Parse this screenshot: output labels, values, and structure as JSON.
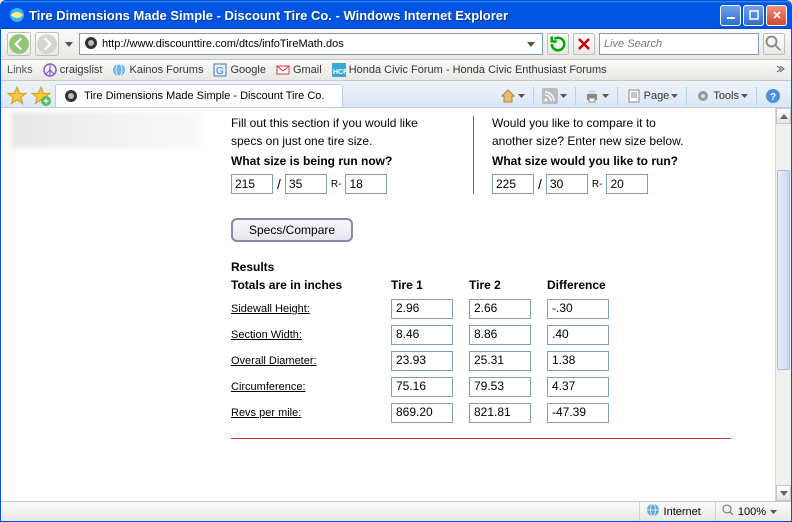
{
  "window": {
    "title": "Tire Dimensions Made Simple - Discount Tire Co. - Windows Internet Explorer"
  },
  "address": {
    "url": "http://www.discounttire.com/dtcs/infoTireMath.dos",
    "search_placeholder": "Live Search"
  },
  "links": {
    "label": "Links",
    "items": [
      "craigslist",
      "Kainos Forums",
      "Google",
      "Gmail",
      "Honda Civic Forum - Honda Civic Enthusiast Forums"
    ]
  },
  "tab": {
    "title": "Tire Dimensions Made Simple - Discount Tire Co."
  },
  "toolbtns": {
    "page": "Page",
    "tools": "Tools"
  },
  "page": {
    "left_line1": "Fill out this section if you would like",
    "left_line2": "specs on just one tire size.",
    "left_q": "What size is being run now?",
    "right_line1": "Would you like to compare it to",
    "right_line2": "another size? Enter new size below.",
    "right_q": "What size would you like to run?",
    "size1": {
      "w": "215",
      "a": "35",
      "d": "18"
    },
    "size2": {
      "w": "225",
      "a": "30",
      "d": "20"
    },
    "slash": "/",
    "r": "R-",
    "specs_btn": "Specs/Compare",
    "results_hdr": "Results",
    "col_totals": "Totals are in inches",
    "col_t1": "Tire 1",
    "col_t2": "Tire 2",
    "col_diff": "Difference",
    "rows": [
      {
        "label": "Sidewall Height:",
        "t1": "2.96",
        "t2": "2.66",
        "d": "-.30"
      },
      {
        "label": "Section Width:",
        "t1": "8.46",
        "t2": "8.86",
        "d": ".40"
      },
      {
        "label": "Overall Diameter:",
        "t1": "23.93",
        "t2": "25.31",
        "d": "1.38"
      },
      {
        "label": "Circumference:",
        "t1": "75.16",
        "t2": "79.53",
        "d": "4.37"
      },
      {
        "label": "Revs per mile:",
        "t1": "869.20",
        "t2": "821.81",
        "d": "-47.39"
      }
    ]
  },
  "status": {
    "zone": "Internet",
    "zoom": "100%"
  }
}
